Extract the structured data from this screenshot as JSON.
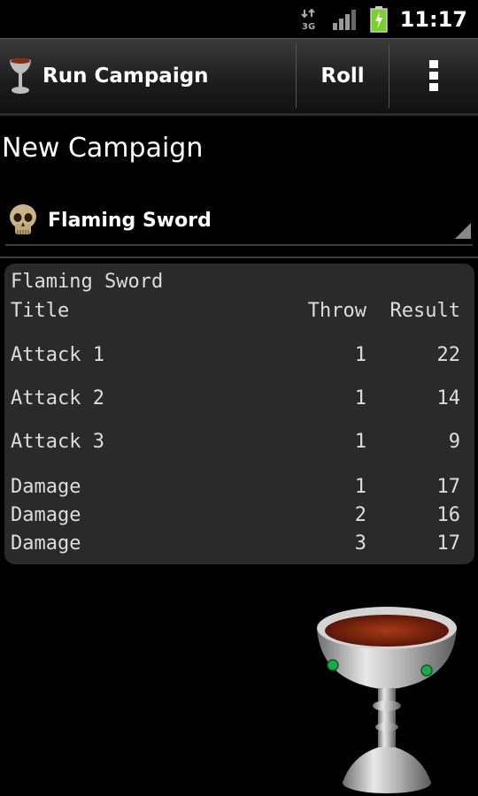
{
  "status_bar": {
    "network": "3G",
    "time": "11:17"
  },
  "action_bar": {
    "title": "Run Campaign",
    "roll_label": "Roll"
  },
  "page_title": "New Campaign",
  "spinner": {
    "selected": "Flaming Sword"
  },
  "results": {
    "name": "Flaming Sword",
    "headers": {
      "title": "Title",
      "throw": "Throw",
      "result": "Result"
    },
    "rows": [
      {
        "title": "Attack 1",
        "throw": "1",
        "result": "22"
      },
      {
        "title": "Attack 2",
        "throw": "1",
        "result": "14"
      },
      {
        "title": "Attack 3",
        "throw": "1",
        "result": "9"
      },
      {
        "title": "Damage",
        "throw": "1",
        "result": "17"
      },
      {
        "title": "Damage",
        "throw": "2",
        "result": "16"
      },
      {
        "title": "Damage",
        "throw": "3",
        "result": "17"
      }
    ]
  },
  "icons": {
    "network": "network-3g-icon",
    "signal": "signal-icon",
    "battery": "battery-charging-icon",
    "logo": "goblet-icon",
    "overflow": "overflow-menu-icon",
    "spinner": "skull-icon",
    "dropdown": "dropdown-triangle-icon",
    "decoration": "goblet-image"
  },
  "colors": {
    "battery": "#7ad12e",
    "panel": "#2a2a2a",
    "wine": "#8a2b12"
  }
}
